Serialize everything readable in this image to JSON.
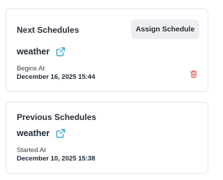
{
  "next_schedules": {
    "title": "Next Schedules",
    "assign_button_label": "Assign Schedule",
    "schedule": {
      "name": "weather",
      "time_label": "Begins At",
      "time_value": "December 16, 2025 15:44",
      "edit_icon": "external-link-icon",
      "delete_icon": "trash-icon"
    }
  },
  "previous_schedules": {
    "title": "Previous Schedules",
    "schedule": {
      "name": "weather",
      "time_label": "Started At",
      "time_value": "December 10, 2025 15:38",
      "edit_icon": "external-link-icon"
    }
  },
  "colors": {
    "accent_link": "#2ba3c7",
    "danger": "#d9534f",
    "button_bg": "#eceef1",
    "card_border": "#e2e5e9"
  }
}
